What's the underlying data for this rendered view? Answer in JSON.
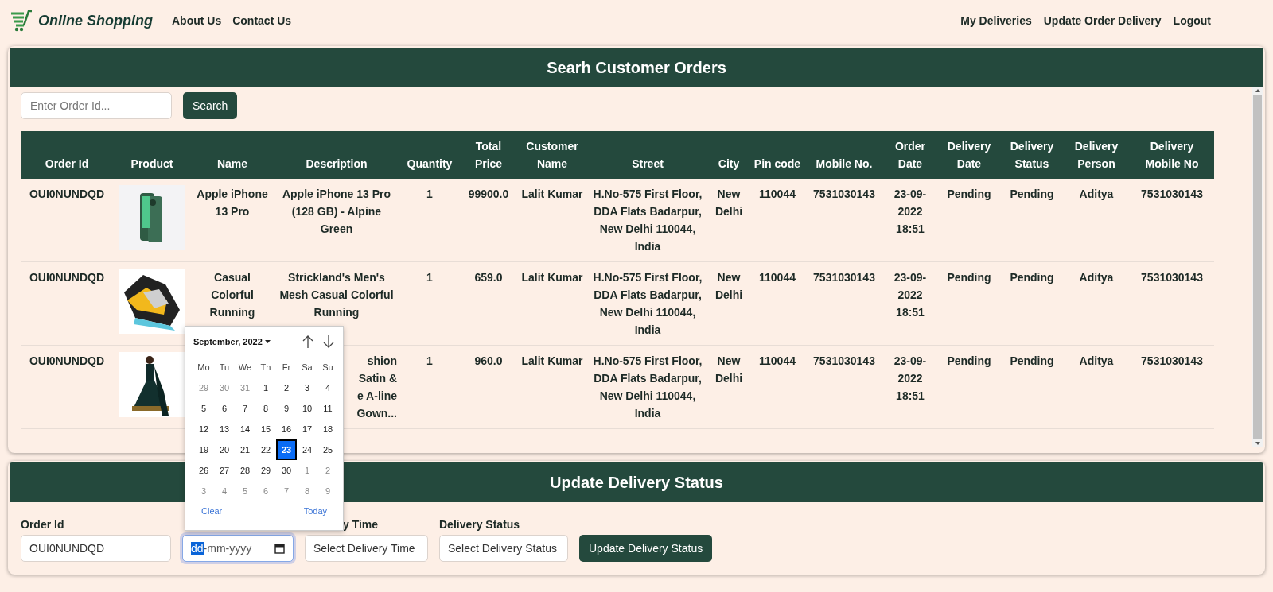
{
  "navbar": {
    "brand": "Online Shopping",
    "left_links": [
      "About Us",
      "Contact Us"
    ],
    "right_links": [
      "My Deliveries",
      "Update Order Delivery",
      "Logout"
    ]
  },
  "search_panel": {
    "title": "Searh Customer Orders",
    "search_placeholder": "Enter Order Id...",
    "search_button": "Search",
    "columns": [
      "Order Id",
      "Product",
      "Name",
      "Description",
      "Quantity",
      "Total Price",
      "Customer Name",
      "Street",
      "City",
      "Pin code",
      "Mobile No.",
      "Order Date",
      "Delivery Date",
      "Delivery Status",
      "Delivery Person",
      "Delivery Mobile No"
    ],
    "rows": [
      {
        "order_id": "OUI0NUNDQD",
        "product": {
          "kind": "phone"
        },
        "name": "Apple iPhone 13 Pro",
        "description": "Apple iPhone 13 Pro (128 GB) - Alpine Green",
        "covered": false,
        "quantity": "1",
        "total_price": "99900.0",
        "customer_name": "Lalit Kumar",
        "street": "H.No-575 First Floor, DDA Flats Badarpur, New Delhi 110044, India",
        "city": "New Delhi",
        "pin_code": "110044",
        "mobile": "7531030143",
        "order_date": "23-09-2022 18:51",
        "delivery_date": "Pending",
        "delivery_status": "Pending",
        "delivery_person": "Aditya",
        "delivery_mobile": "7531030143"
      },
      {
        "order_id": "OUI0NUNDQD",
        "product": {
          "kind": "shoe"
        },
        "name": "Casual Colorful Running",
        "description": "Strickland's Men's Mesh Casual Colorful Running",
        "covered": false,
        "quantity": "1",
        "total_price": "659.0",
        "customer_name": "Lalit Kumar",
        "street": "H.No-575 First Floor, DDA Flats Badarpur, New Delhi 110044, India",
        "city": "New Delhi",
        "pin_code": "110044",
        "mobile": "7531030143",
        "order_date": "23-09-2022 18:51",
        "delivery_date": "Pending",
        "delivery_status": "Pending",
        "delivery_person": "Aditya",
        "delivery_mobile": "7531030143"
      },
      {
        "order_id": "OUI0NUNDQD",
        "product": {
          "kind": "gown"
        },
        "description": "shion\nSatin &\ne A-line\nGown...",
        "covered": true,
        "quantity": "1",
        "total_price": "960.0",
        "customer_name": "Lalit Kumar",
        "street": "H.No-575 First Floor, DDA Flats Badarpur, New Delhi 110044, India",
        "city": "New Delhi",
        "pin_code": "110044",
        "mobile": "7531030143",
        "order_date": "23-09-2022 18:51",
        "delivery_date": "Pending",
        "delivery_status": "Pending",
        "delivery_person": "Aditya",
        "delivery_mobile": "7531030143"
      }
    ]
  },
  "update_panel": {
    "title": "Update Delivery Status",
    "fields": [
      {
        "kind": "text",
        "label": "Order Id",
        "value": "OUI0NUNDQD"
      },
      {
        "kind": "date",
        "covered": true,
        "segments": [
          {
            "text": "dd",
            "selected": true
          },
          {
            "text": "-mm-yyyy",
            "selected": false
          }
        ]
      },
      {
        "kind": "select",
        "label": "y Time",
        "covered": true,
        "value": "Select Delivery Time"
      },
      {
        "kind": "select",
        "label": "Delivery Status",
        "value": "Select Delivery Status"
      }
    ],
    "button": "Update Delivery Status"
  },
  "date_picker": {
    "month": "September, 2022",
    "weekdays": [
      "Mo",
      "Tu",
      "We",
      "Th",
      "Fr",
      "Sa",
      "Su"
    ],
    "days": [
      {
        "day": "29",
        "outside": true,
        "selected": false
      },
      {
        "day": "30",
        "outside": true,
        "selected": false
      },
      {
        "day": "31",
        "outside": true,
        "selected": false
      },
      {
        "day": "1",
        "outside": false,
        "selected": false
      },
      {
        "day": "2",
        "outside": false,
        "selected": false
      },
      {
        "day": "3",
        "outside": false,
        "selected": false
      },
      {
        "day": "4",
        "outside": false,
        "selected": false
      },
      {
        "day": "5",
        "outside": false,
        "selected": false
      },
      {
        "day": "6",
        "outside": false,
        "selected": false
      },
      {
        "day": "7",
        "outside": false,
        "selected": false
      },
      {
        "day": "8",
        "outside": false,
        "selected": false
      },
      {
        "day": "9",
        "outside": false,
        "selected": false
      },
      {
        "day": "10",
        "outside": false,
        "selected": false
      },
      {
        "day": "11",
        "outside": false,
        "selected": false
      },
      {
        "day": "12",
        "outside": false,
        "selected": false
      },
      {
        "day": "13",
        "outside": false,
        "selected": false
      },
      {
        "day": "14",
        "outside": false,
        "selected": false
      },
      {
        "day": "15",
        "outside": false,
        "selected": false
      },
      {
        "day": "16",
        "outside": false,
        "selected": false
      },
      {
        "day": "17",
        "outside": false,
        "selected": false
      },
      {
        "day": "18",
        "outside": false,
        "selected": false
      },
      {
        "day": "19",
        "outside": false,
        "selected": false
      },
      {
        "day": "20",
        "outside": false,
        "selected": false
      },
      {
        "day": "21",
        "outside": false,
        "selected": false
      },
      {
        "day": "22",
        "outside": false,
        "selected": false
      },
      {
        "day": "23",
        "outside": false,
        "selected": true
      },
      {
        "day": "24",
        "outside": false,
        "selected": false
      },
      {
        "day": "25",
        "outside": false,
        "selected": false
      },
      {
        "day": "26",
        "outside": false,
        "selected": false
      },
      {
        "day": "27",
        "outside": false,
        "selected": false
      },
      {
        "day": "28",
        "outside": false,
        "selected": false
      },
      {
        "day": "29",
        "outside": false,
        "selected": false
      },
      {
        "day": "30",
        "outside": false,
        "selected": false
      },
      {
        "day": "1",
        "outside": true,
        "selected": false
      },
      {
        "day": "2",
        "outside": true,
        "selected": false
      },
      {
        "day": "3",
        "outside": true,
        "selected": false
      },
      {
        "day": "4",
        "outside": true,
        "selected": false
      },
      {
        "day": "5",
        "outside": true,
        "selected": false
      },
      {
        "day": "6",
        "outside": true,
        "selected": false
      },
      {
        "day": "7",
        "outside": true,
        "selected": false
      },
      {
        "day": "8",
        "outside": true,
        "selected": false
      },
      {
        "day": "9",
        "outside": true,
        "selected": false
      }
    ],
    "clear": "Clear",
    "today": "Today"
  }
}
